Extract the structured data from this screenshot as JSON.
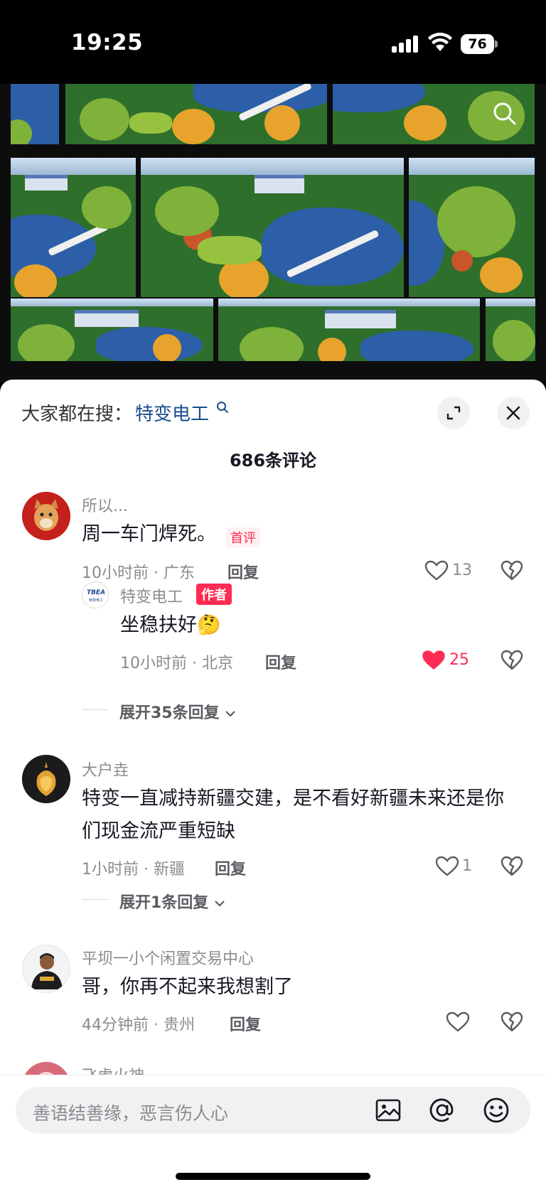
{
  "status_bar": {
    "time": "19:25",
    "battery": "76"
  },
  "hot_search": {
    "label": "大家都在搜：",
    "term": "特变电工"
  },
  "comment_count": "686条评论",
  "comments": [
    {
      "username": "所以...",
      "text": "周一车门焊死。",
      "badge": "首评",
      "meta": "10小时前 · 广东",
      "reply": "回复",
      "likes": "13",
      "replies": [
        {
          "username": "特变电工",
          "badge": "作者",
          "avatar_text": "TBEA",
          "avatar_sub": "特变电工",
          "text": "坐稳扶好",
          "emoji": "🤔",
          "meta": "10小时前 · 北京",
          "reply": "回复",
          "likes": "25",
          "liked": true
        }
      ],
      "expand": "展开35条回复"
    },
    {
      "username": "大户垚",
      "text_line1": "特变一直减持新疆交建，是不看好新疆未来还是你",
      "text_line2": "们现金流严重短缺",
      "meta": "1小时前 · 新疆",
      "reply": "回复",
      "likes": "1",
      "expand": "展开1条回复"
    },
    {
      "username": "平坝一小个闲置交易中心",
      "text": "哥，你再不起来我想割了",
      "meta": "44分钟前 · 贵州",
      "reply": "回复",
      "likes": ""
    },
    {
      "username": "飞虎火神"
    }
  ],
  "input": {
    "placeholder": "善语结善缘，恶言伤人心"
  },
  "colors": {
    "accent": "#fe2c55",
    "link": "#1a4d8c",
    "muted": "#8a8b91"
  },
  "icons": [
    "search-icon",
    "expand-icon",
    "close-icon",
    "heart-icon",
    "dislike-icon",
    "chevron-down-icon",
    "image-icon",
    "at-icon",
    "emoji-icon"
  ]
}
